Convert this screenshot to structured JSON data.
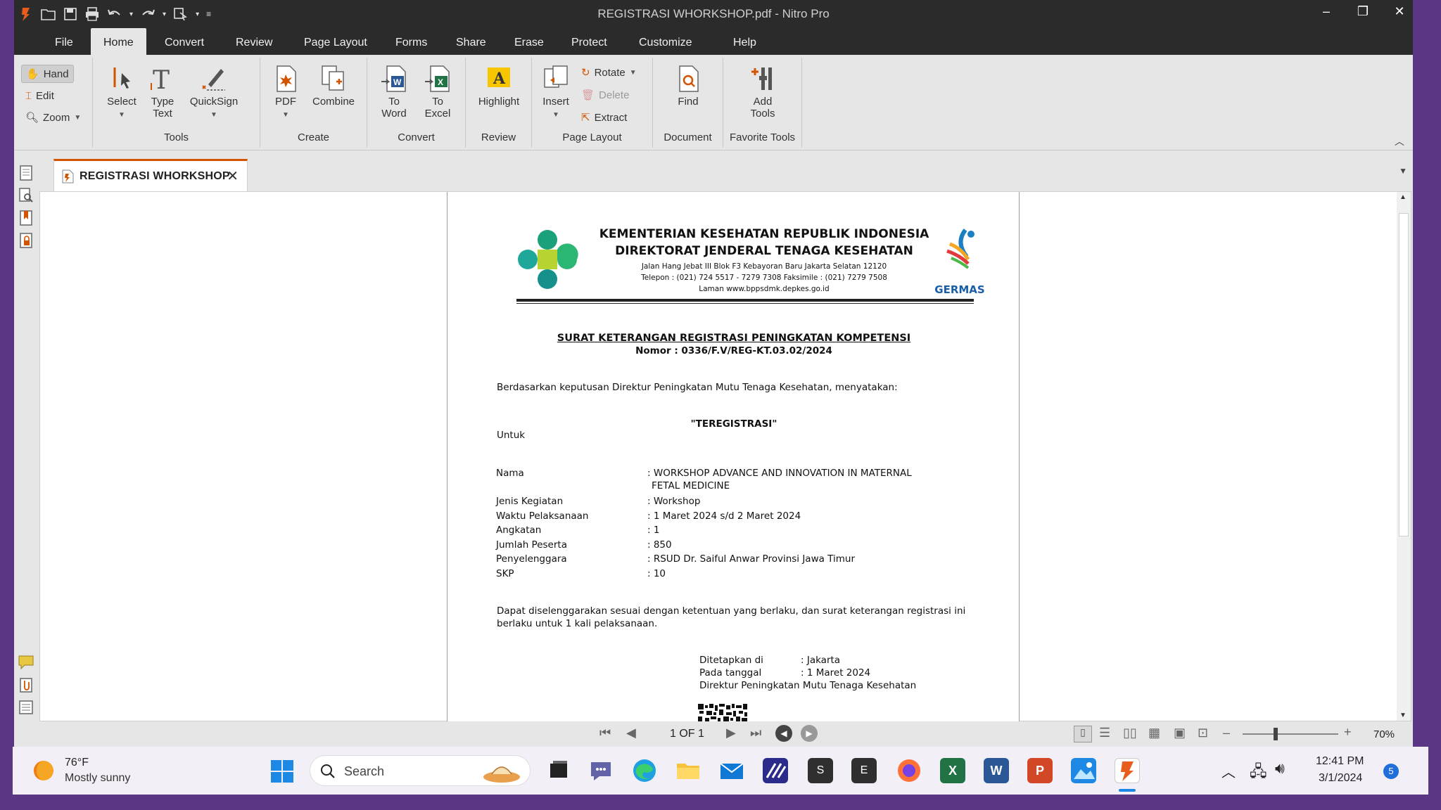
{
  "window": {
    "title": "REGISTRASI WHORKSHOP.pdf - Nitro Pro"
  },
  "menu": [
    "File",
    "Home",
    "Convert",
    "Review",
    "Page Layout",
    "Forms",
    "Share",
    "Erase",
    "Protect",
    "Customize",
    "Help"
  ],
  "ribbon": {
    "tools_group": {
      "label": "Tools",
      "hand": "Hand",
      "edit": "Edit",
      "zoom": "Zoom",
      "select": "Select",
      "type_text_1": "Type",
      "type_text_2": "Text",
      "quicksign": "QuickSign"
    },
    "create_group": {
      "label": "Create",
      "pdf": "PDF",
      "combine": "Combine"
    },
    "convert_group": {
      "label": "Convert",
      "to_word_1": "To",
      "to_word_2": "Word",
      "to_excel_1": "To",
      "to_excel_2": "Excel"
    },
    "review_group": {
      "label": "Review",
      "highlight": "Highlight"
    },
    "page_layout_group": {
      "label": "Page Layout",
      "insert": "Insert",
      "rotate": "Rotate",
      "delete": "Delete",
      "extract": "Extract"
    },
    "document_group": {
      "label": "Document",
      "find": "Find"
    },
    "favorite_group": {
      "label": "Favorite Tools",
      "add_1": "Add",
      "add_2": "Tools"
    }
  },
  "tab": {
    "label": "REGISTRASI WHORKSHOP"
  },
  "document": {
    "ministry": "KEMENTERIAN KESEHATAN REPUBLIK INDONESIA",
    "directorate": "DIREKTORAT JENDERAL TENAGA KESEHATAN",
    "address": "Jalan Hang Jebat III Blok F3 Kebayoran Baru Jakarta Selatan 12120",
    "phone": "Telepon : (021) 724 5517 - 7279 7308  Faksimile : (021) 7279 7508",
    "website": "Laman www.bppsdmk.depkes.go.id",
    "germas": "GERMAS",
    "doc_title": "SURAT KETERANGAN REGISTRASI PENINGKATAN KOMPETENSI",
    "doc_number": "Nomor : 0336/F.V/REG-KT.03.02/2024",
    "intro": "Berdasarkan keputusan Direktur Peningkatan Mutu Tenaga Kesehatan, menyatakan:",
    "status": "\"TEREGISTRASI\"",
    "untuk": "Untuk",
    "fields": [
      {
        "label": "Nama",
        "value": ": WORKSHOP ADVANCE AND INNOVATION IN MATERNAL",
        "value2": "FETAL MEDICINE"
      },
      {
        "label": "Jenis Kegiatan",
        "value": ": Workshop"
      },
      {
        "label": "Waktu Pelaksanaan",
        "value": ": 1 Maret 2024 s/d 2 Maret 2024"
      },
      {
        "label": "Angkatan",
        "value": ": 1"
      },
      {
        "label": "Jumlah Peserta",
        "value": ": 850"
      },
      {
        "label": "Penyelenggara",
        "value": ": RSUD Dr. Saiful Anwar Provinsi Jawa Timur"
      },
      {
        "label": "SKP",
        "value": ": 10"
      }
    ],
    "closing_1": "Dapat diselenggarakan sesuai dengan ketentuan yang berlaku, dan surat keterangan registrasi ini",
    "closing_2": "berlaku untuk 1 kali pelaksanaan.",
    "ditetapkan_label": "Ditetapkan di",
    "ditetapkan_value": ": Jakarta",
    "tanggal_label": "Pada tanggal",
    "tanggal_value": ": 1 Maret 2024",
    "signer": "Direktur Peningkatan Mutu Tenaga Kesehatan"
  },
  "status_bar": {
    "page": "1 OF 1",
    "zoom": "70%"
  },
  "taskbar": {
    "weather_temp": "76°F",
    "weather_desc": "Mostly sunny",
    "search": "Search",
    "time": "12:41 PM",
    "date": "3/1/2024",
    "notif_count": "5"
  },
  "colors": {
    "accent": "#d35400",
    "titlebar": "#2b2b2b",
    "ribbon": "#e6e6e6"
  }
}
